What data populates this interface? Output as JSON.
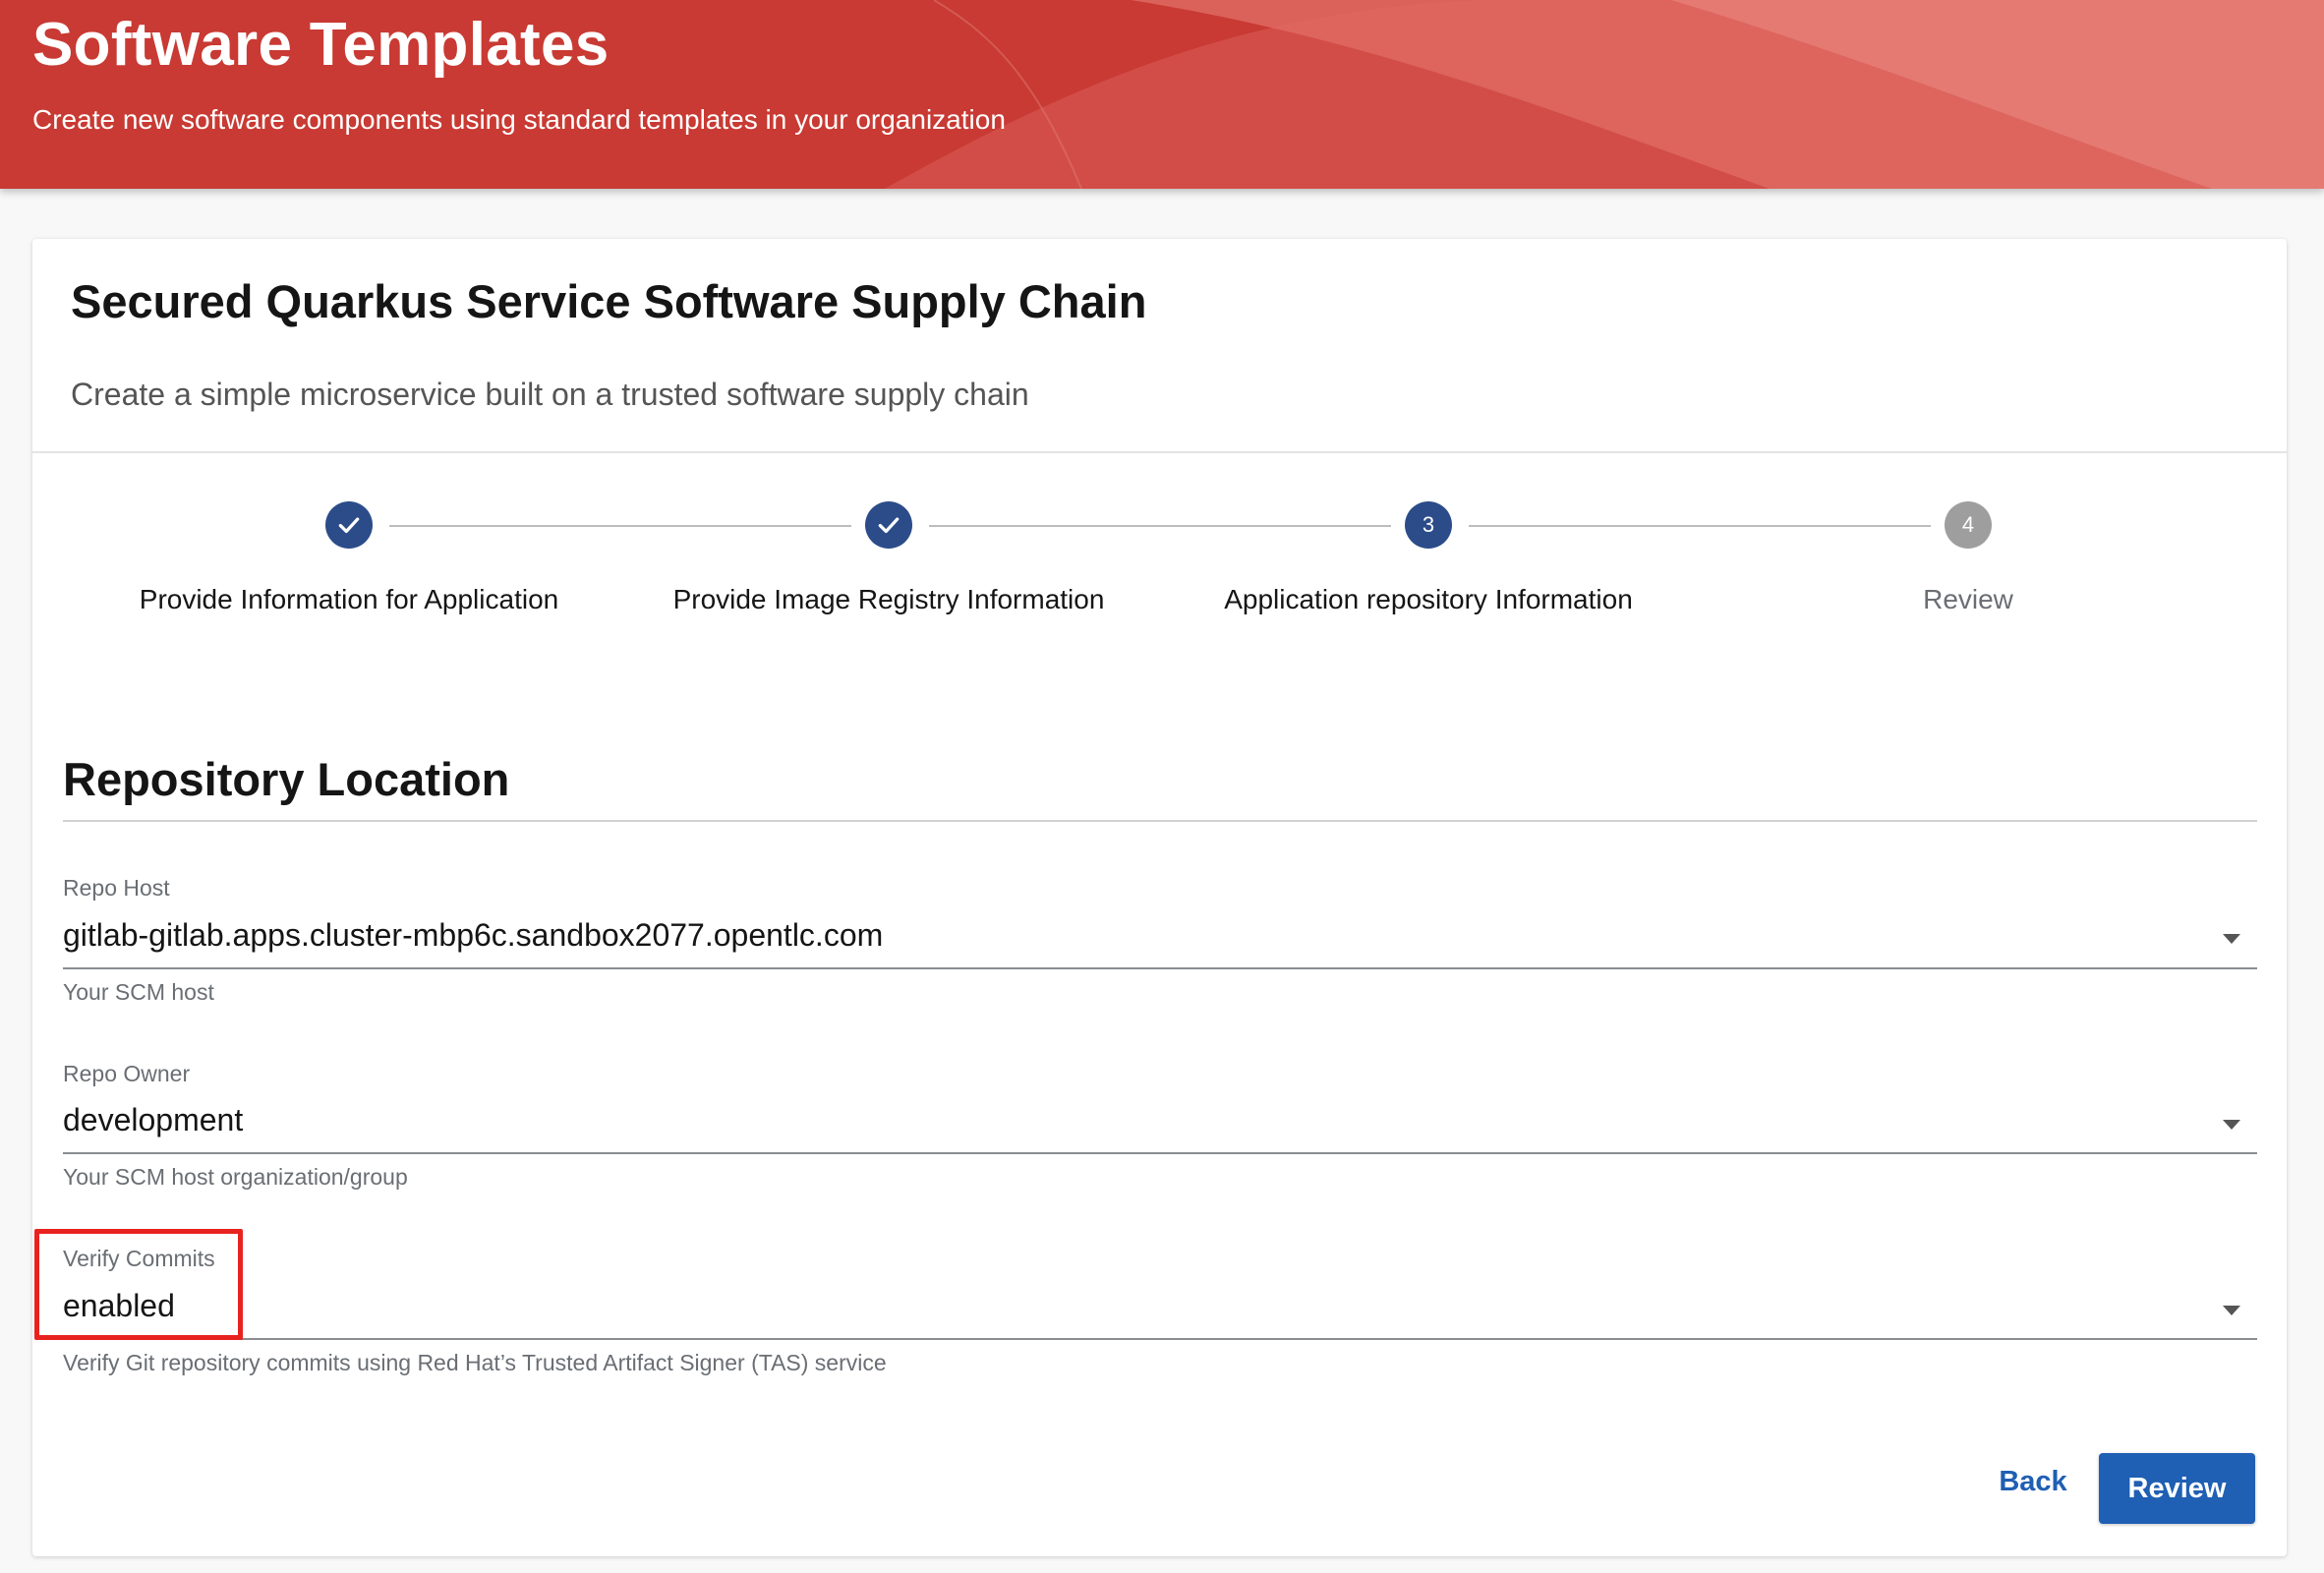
{
  "header": {
    "title": "Software Templates",
    "subtitle": "Create new software components using standard templates in your organization"
  },
  "card": {
    "title": "Secured Quarkus Service Software Supply Chain",
    "description": "Create a simple microservice built on a trusted software supply chain"
  },
  "stepper": {
    "steps": [
      {
        "label": "Provide Information for Application",
        "number": "1",
        "state": "completed"
      },
      {
        "label": "Provide Image Registry Information",
        "number": "2",
        "state": "completed"
      },
      {
        "label": "Application repository Information",
        "number": "3",
        "state": "active"
      },
      {
        "label": "Review",
        "number": "4",
        "state": "pending"
      }
    ]
  },
  "section": {
    "title": "Repository Location"
  },
  "fields": {
    "repo_host": {
      "label": "Repo Host",
      "value": "gitlab-gitlab.apps.cluster-mbp6c.sandbox2077.opentlc.com",
      "help": "Your SCM host"
    },
    "repo_owner": {
      "label": "Repo Owner",
      "value": "development",
      "help": "Your SCM host organization/group"
    },
    "verify_commits": {
      "label": "Verify Commits",
      "value": "enabled",
      "help": "Verify Git repository commits using Red Hat’s Trusted Artifact Signer (TAS) service"
    }
  },
  "actions": {
    "back_label": "Back",
    "review_label": "Review"
  },
  "colors": {
    "header_red": "#c9302c",
    "step_blue": "#2b4c89",
    "primary_blue": "#1f5fb4",
    "highlight_red": "#e8231f"
  }
}
